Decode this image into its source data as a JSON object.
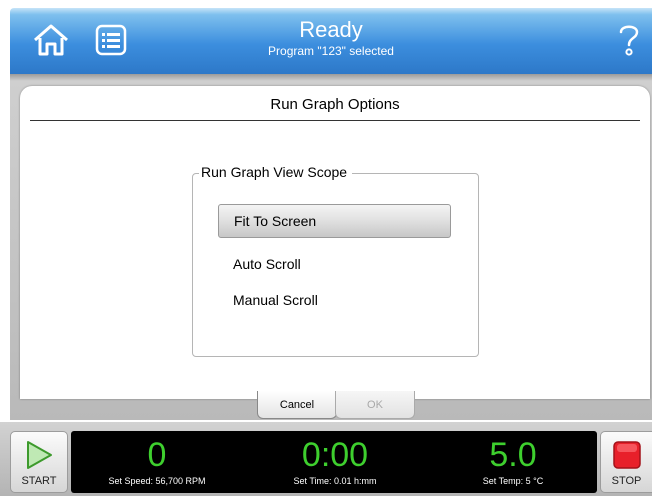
{
  "header": {
    "title": "Ready",
    "subtitle": "Program \"123\" selected",
    "home_icon": "home-icon",
    "menu_icon": "list-icon",
    "help_icon": "question-icon",
    "colors": {
      "top": "#7ec0ee",
      "bottom": "#2d78c8"
    }
  },
  "page": {
    "title": "Run Graph Options"
  },
  "scope_group": {
    "legend": "Run Graph View Scope",
    "options": [
      {
        "label": "Fit To Screen",
        "selected": true
      },
      {
        "label": "Auto Scroll",
        "selected": false
      },
      {
        "label": "Manual Scroll",
        "selected": false
      }
    ]
  },
  "dialog_buttons": {
    "cancel": "Cancel",
    "ok": "OK"
  },
  "controls": {
    "start_label": "START",
    "stop_label": "STOP",
    "start_icon": "play-icon",
    "stop_icon": "stop-icon"
  },
  "readouts": {
    "speed": {
      "value": "0",
      "caption": "Set Speed: 56,700 RPM"
    },
    "time": {
      "value": "0:00",
      "caption": "Set Time: 0.01 h:mm"
    },
    "temp": {
      "value": "5.0",
      "caption": "Set Temp: 5 °C"
    },
    "value_color": "#3ecf2e"
  }
}
